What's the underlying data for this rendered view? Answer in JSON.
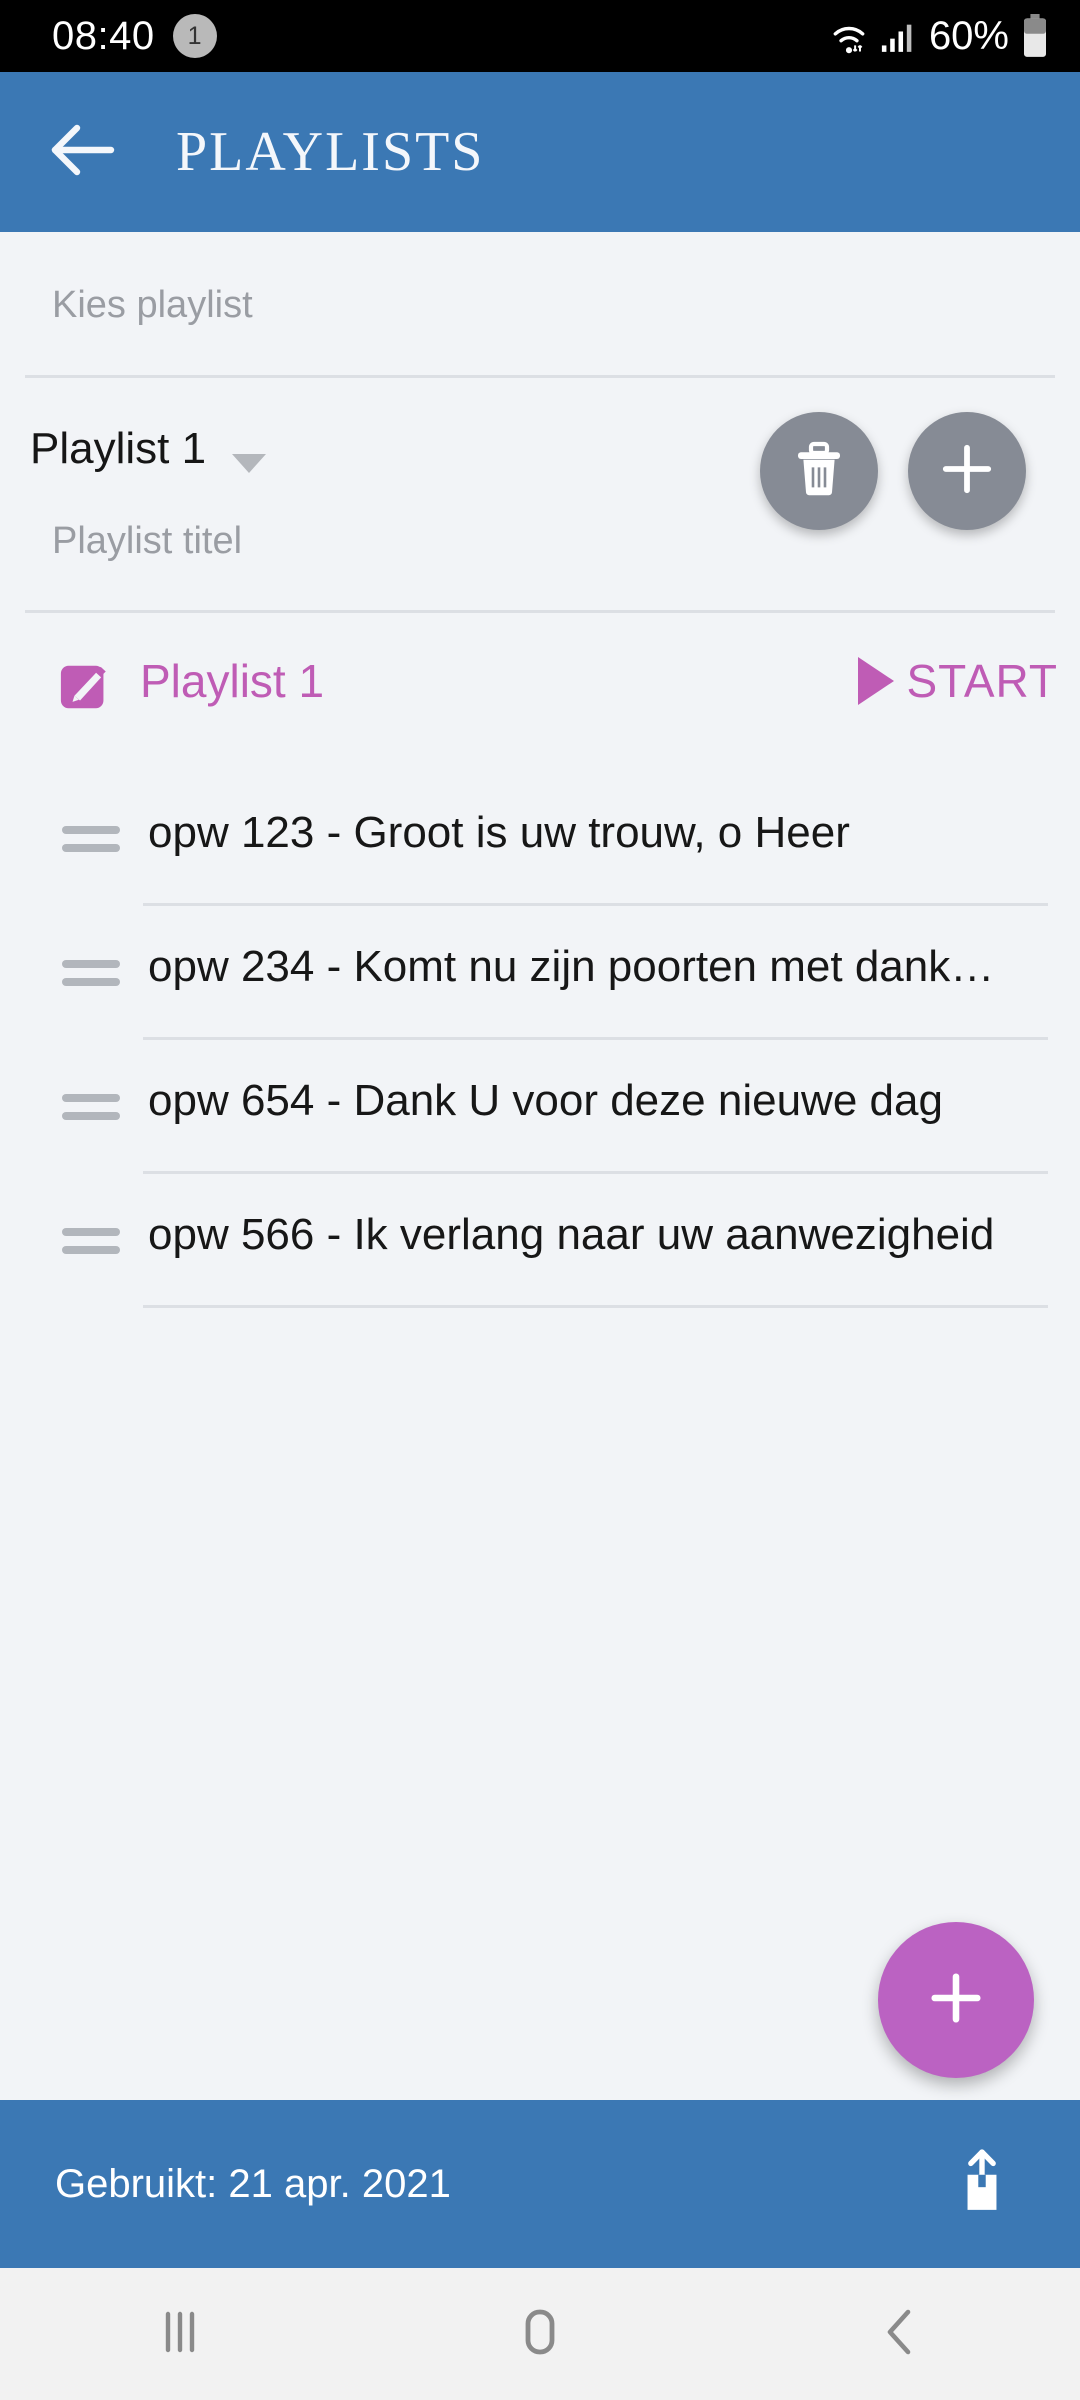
{
  "status_bar": {
    "time": "08:40",
    "notification_count": "1",
    "battery_percent": "60%",
    "icons": [
      "wifi-icon",
      "cellular-signal-icon",
      "battery-icon"
    ]
  },
  "app_bar": {
    "back_icon": "arrow-left-icon",
    "title": "PLAYLISTS",
    "background_color": "#3b78b4"
  },
  "selector": {
    "label": "Kies playlist",
    "value": "Playlist 1",
    "caret_icon": "chevron-down-icon",
    "delete_icon": "trash-icon",
    "add_icon": "plus-icon",
    "button_color": "#868b95"
  },
  "title_section": {
    "label": "Playlist titel",
    "edit_icon": "edit-pencil-icon",
    "value": "Playlist 1",
    "play_icon": "play-triangle-icon",
    "start_label": "START",
    "accent_color": "#bf5cb5"
  },
  "songs": {
    "drag_icon": "drag-handle-icon",
    "items": [
      {
        "title": "opw 123 - Groot is uw trouw, o Heer"
      },
      {
        "title": "opw 234 - Komt nu zijn poorten met dank…"
      },
      {
        "title": "opw 654 - Dank U voor deze nieuwe dag"
      },
      {
        "title": "opw 566 - Ik verlang naar uw aanwezigheid"
      }
    ]
  },
  "fab": {
    "icon": "plus-icon",
    "color": "#bb62c2"
  },
  "bottom_bar": {
    "used_text": "Gebruikt: 21 apr. 2021",
    "share_icon": "share-upload-icon",
    "background_color": "#3b78b4"
  },
  "nav_bar": {
    "recents_icon": "recents-icon",
    "home_icon": "home-icon",
    "back_icon": "back-chevron-icon"
  }
}
